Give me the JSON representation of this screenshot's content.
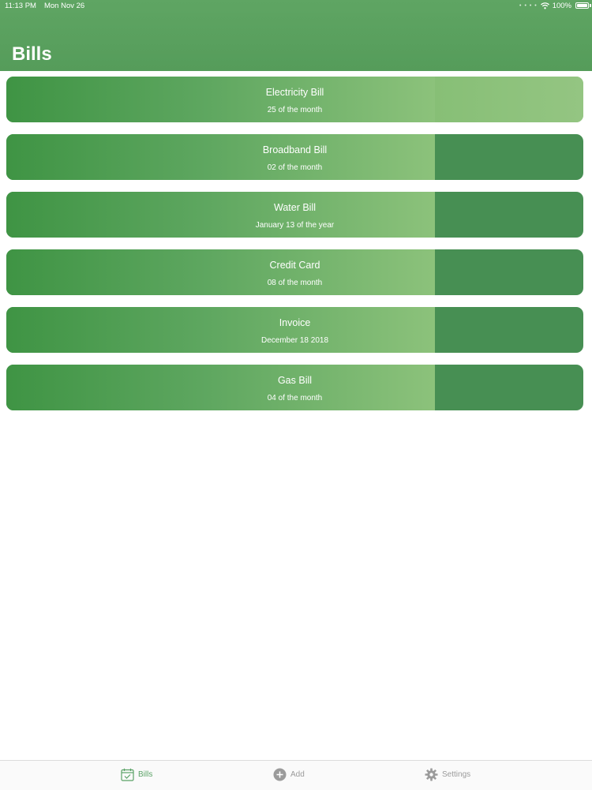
{
  "status_bar": {
    "time": "11:13 PM",
    "date": "Mon Nov 26",
    "battery": "100%",
    "icons": [
      "wifi-icon",
      "battery-icon"
    ]
  },
  "header": {
    "title": "Bills"
  },
  "bills": [
    {
      "name": "Electricity Bill",
      "date": "25 of the month"
    },
    {
      "name": "Broadband Bill",
      "date": "02 of the month"
    },
    {
      "name": "Water Bill",
      "date": "January 13 of the year"
    },
    {
      "name": "Credit Card",
      "date": "08 of the month"
    },
    {
      "name": "Invoice",
      "date": "December 18 2018"
    },
    {
      "name": "Gas Bill",
      "date": "04 of the month"
    }
  ],
  "tab_bar": {
    "tabs": [
      {
        "label": "Bills",
        "icon": "calendar-check-icon",
        "active": true
      },
      {
        "label": "Add",
        "icon": "plus-circle-icon",
        "active": false
      },
      {
        "label": "Settings",
        "icon": "gear-icon",
        "active": false
      }
    ]
  },
  "colors": {
    "header": "#5aa15e",
    "card_start": "#3f9444",
    "card_end": "#8cc27b",
    "card_tail": "#478f53",
    "tab_active": "#5aa266",
    "tab_inactive": "#9b9b9b"
  }
}
